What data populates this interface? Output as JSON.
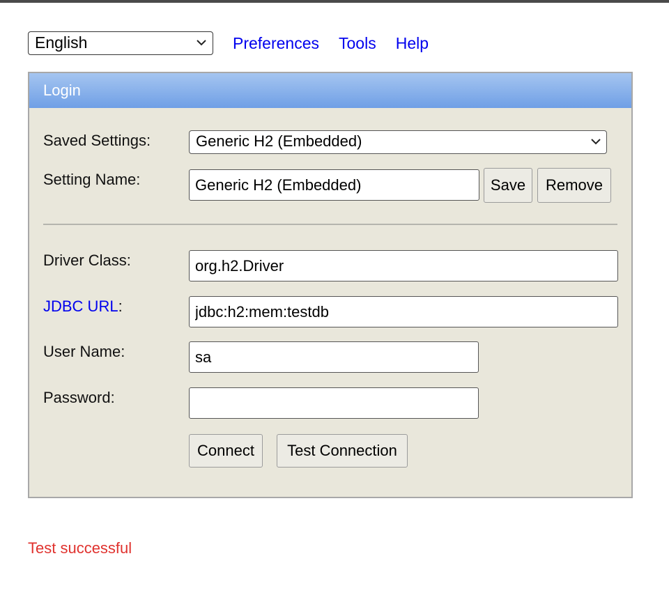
{
  "topbar": {
    "language_selected": "English",
    "links": [
      "Preferences",
      "Tools",
      "Help"
    ]
  },
  "login": {
    "title": "Login",
    "saved_settings_label": "Saved Settings:",
    "saved_settings_value": "Generic H2 (Embedded)",
    "setting_name_label": "Setting Name:",
    "setting_name_value": "Generic H2 (Embedded)",
    "save_label": "Save",
    "remove_label": "Remove",
    "driver_class_label": "Driver Class:",
    "driver_class_value": "org.h2.Driver",
    "jdbc_url_link": "JDBC URL",
    "jdbc_url_suffix": ":",
    "jdbc_url_value": "jdbc:h2:mem:testdb",
    "user_name_label": "User Name:",
    "user_name_value": "sa",
    "password_label": "Password:",
    "password_value": "",
    "connect_label": "Connect",
    "test_connection_label": "Test Connection"
  },
  "status": {
    "message": "Test successful"
  },
  "colors": {
    "link": "#0000ee",
    "panel_bg": "#e9e7db",
    "header_top": "#a5c5f0",
    "header_bottom": "#6f9fe6",
    "status": "#e0322e"
  },
  "icons": {
    "select_chevron": "chevron-down-icon"
  }
}
